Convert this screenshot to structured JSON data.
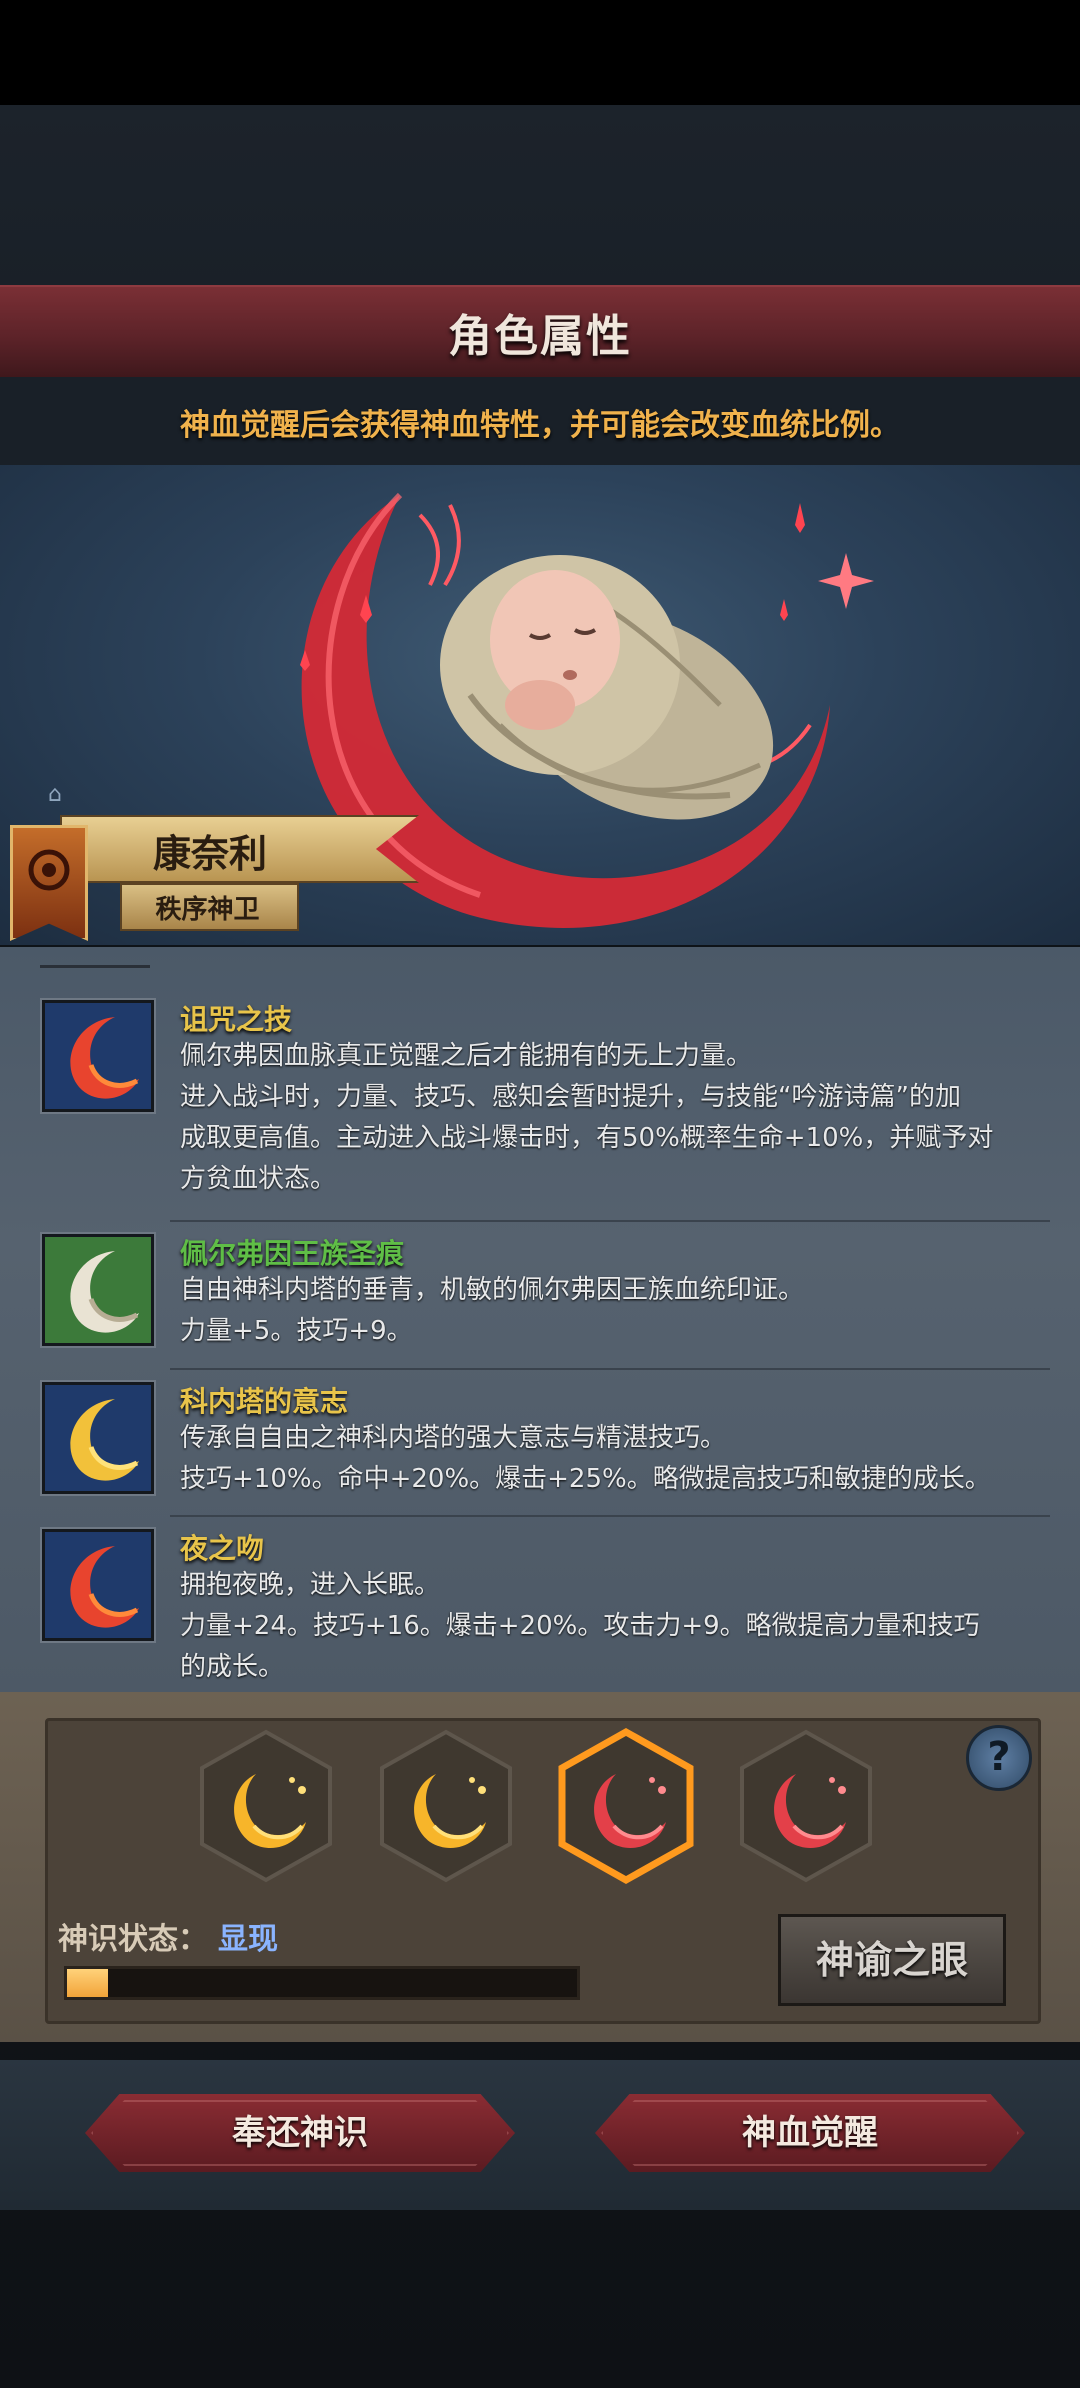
{
  "header": {
    "title": "角色属性",
    "hint": "神血觉醒后会获得神血特性，并可能会改变血统比例。"
  },
  "character": {
    "name": "康奈利",
    "title": "秩序神卫"
  },
  "traits": [
    {
      "name": "诅咒之技",
      "name_color": "#e8c44a",
      "icon": "red-crescent-icon",
      "lines": [
        "佩尔弗因血脉真正觉醒之后才能拥有的无上力量。",
        "进入战斗时，力量、技巧、感知会暂时提升，与技能“吟游诗篇”的加",
        "成取更高值。主动进入战斗爆击时，有50%概率生命+10%，并赋予对",
        "方贫血状态。"
      ]
    },
    {
      "name": "佩尔弗因王族圣痕",
      "name_color": "#5fbe46",
      "icon": "white-crescent-icon",
      "lines": [
        "自由神科内塔的垂青，机敏的佩尔弗因王族血统印证。",
        "力量+5。技巧+9。"
      ]
    },
    {
      "name": "科内塔的意志",
      "name_color": "#e8c44a",
      "icon": "gold-crescent-icon",
      "lines": [
        "传承自自由之神科内塔的强大意志与精湛技巧。",
        "技巧+10%。命中+20%。爆击+25%。略微提高技巧和敏捷的成长。"
      ]
    },
    {
      "name": "夜之吻",
      "name_color": "#e8c44a",
      "icon": "red-crescent-icon",
      "lines": [
        "拥抱夜晚，进入长眠。",
        "力量+24。技巧+16。爆击+20%。攻击力+9。略微提高力量和技巧",
        "的成长。"
      ]
    }
  ],
  "awakening": {
    "slots": [
      {
        "icon": "gold-crescent-icon",
        "selected": false
      },
      {
        "icon": "gold-crescent-icon",
        "selected": false
      },
      {
        "icon": "red-crescent-icon",
        "selected": true
      },
      {
        "icon": "red-crescent-icon",
        "selected": false
      }
    ],
    "status_label": "神识状态：",
    "status_value": "显现",
    "progress": 0.08,
    "oracle_button": "神谕之眼",
    "help_label": "?"
  },
  "footer": {
    "return_button": "奉还神识",
    "awaken_button": "神血觉醒"
  }
}
